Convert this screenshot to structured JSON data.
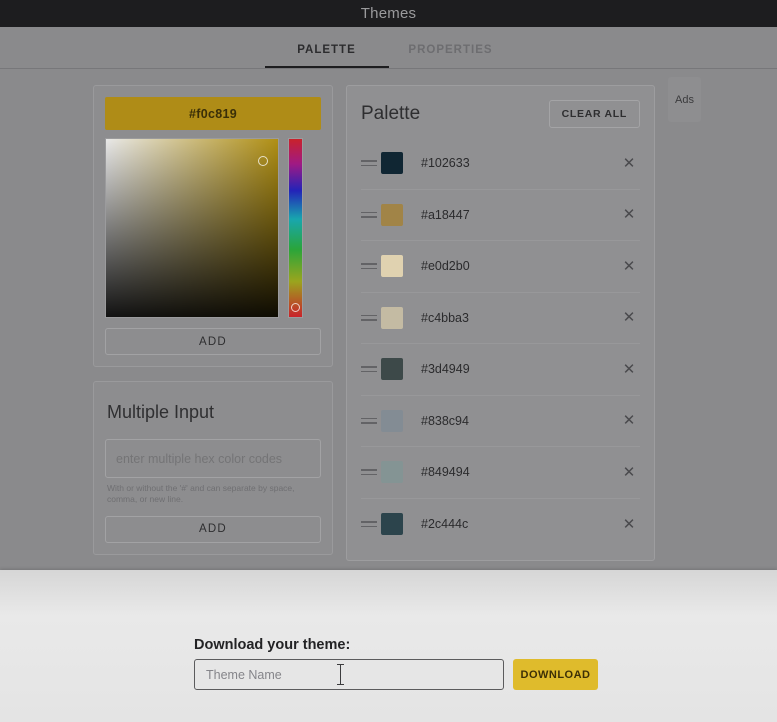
{
  "window": {
    "title": "Themes"
  },
  "tabs": [
    {
      "label": "PALETTE",
      "active": true
    },
    {
      "label": "PROPERTIES",
      "active": false
    }
  ],
  "picker": {
    "current_hex": "#f0c819",
    "add_label": "ADD",
    "swatch_header_color": "#f0c819"
  },
  "multiple_input": {
    "title": "Multiple Input",
    "placeholder": "enter multiple hex color codes",
    "value": "",
    "hint": "With or without the '#' and can separate by space, comma, or new line.",
    "add_label": "ADD"
  },
  "palette": {
    "title": "Palette",
    "clear_all_label": "CLEAR ALL",
    "remove_glyph": "✕",
    "items": [
      {
        "hex": "#102633"
      },
      {
        "hex": "#a18447"
      },
      {
        "hex": "#e0d2b0"
      },
      {
        "hex": "#c4bba3"
      },
      {
        "hex": "#3d4949"
      },
      {
        "hex": "#838c94"
      },
      {
        "hex": "#849494"
      },
      {
        "hex": "#2c444c"
      }
    ]
  },
  "ads": {
    "label": "Ads"
  },
  "download": {
    "label": "Download your theme:",
    "input_placeholder": "Theme Name",
    "input_value": "",
    "button_label": "DOWNLOAD",
    "button_color": "#dfbb2c"
  }
}
